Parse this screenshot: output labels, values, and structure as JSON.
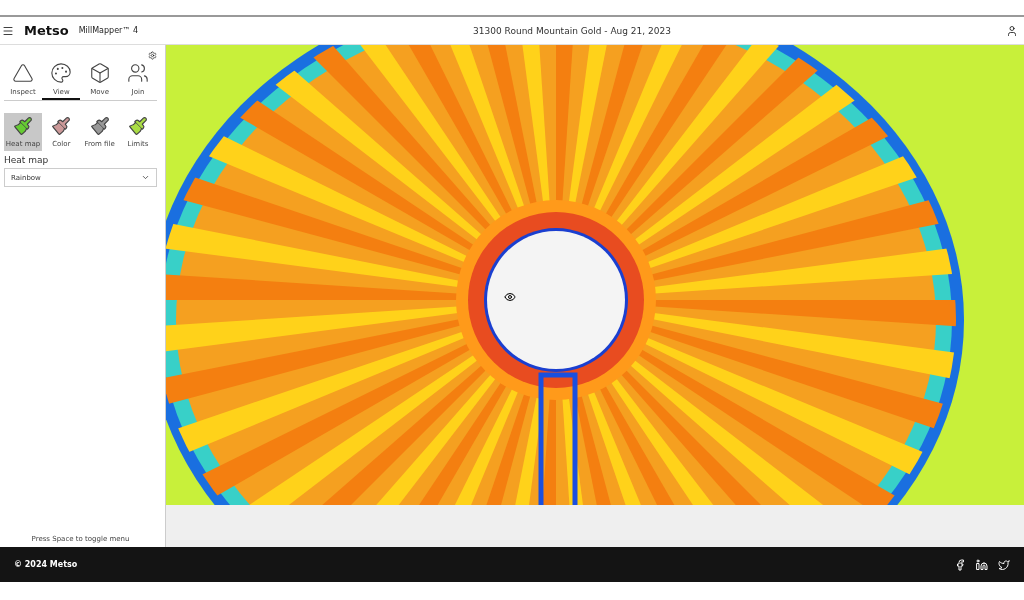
{
  "header": {
    "brand": "Metso",
    "product": "MillMapper™ 4",
    "title": "31300 Round Mountain Gold - Aug 21, 2023"
  },
  "tools": [
    {
      "label": "Inspect",
      "selected": false
    },
    {
      "label": "View",
      "selected": true
    },
    {
      "label": "Move",
      "selected": false
    },
    {
      "label": "Join",
      "selected": false
    }
  ],
  "paints": [
    {
      "label": "Heat map",
      "selected": true
    },
    {
      "label": "Color",
      "selected": false
    },
    {
      "label": "From file",
      "selected": false
    },
    {
      "label": "Limits",
      "selected": false
    }
  ],
  "heat_map_field": {
    "label": "Heat map",
    "value": "Rainbow"
  },
  "hint": "Press Space to toggle menu",
  "footer": {
    "copyright": "© 2024 Metso"
  }
}
